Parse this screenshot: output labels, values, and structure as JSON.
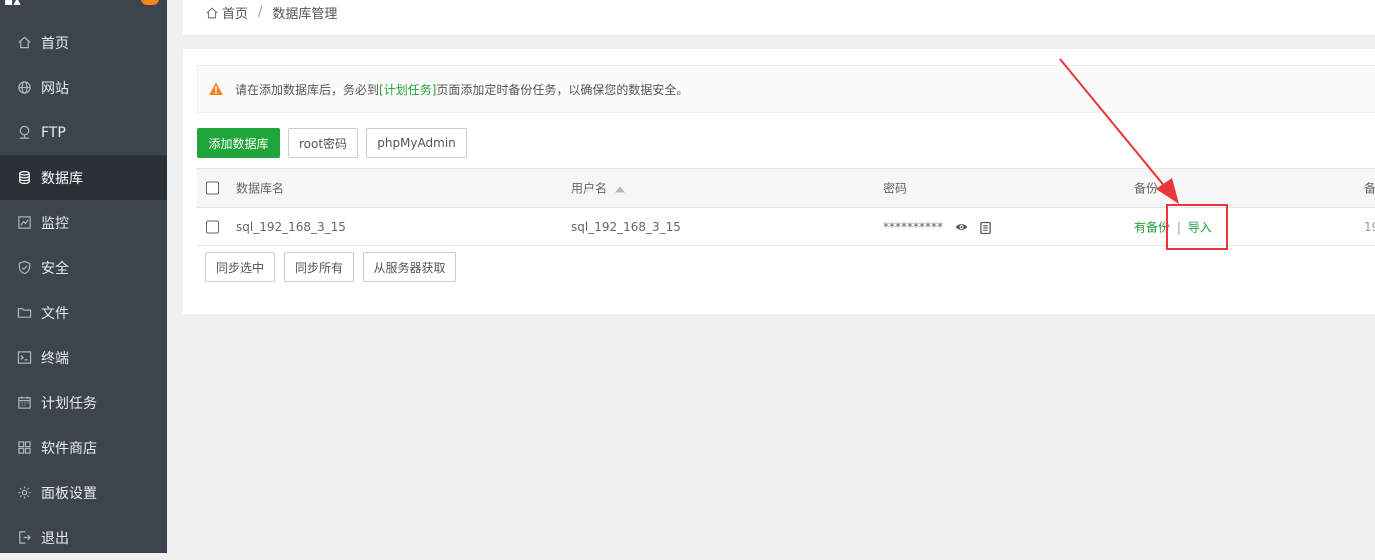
{
  "sidebar": {
    "items": [
      {
        "label": "首页",
        "icon": "home-icon"
      },
      {
        "label": "网站",
        "icon": "globe-icon"
      },
      {
        "label": "FTP",
        "icon": "ftp-icon"
      },
      {
        "label": "数据库",
        "icon": "database-icon",
        "active": true
      },
      {
        "label": "监控",
        "icon": "monitor-icon"
      },
      {
        "label": "安全",
        "icon": "shield-icon"
      },
      {
        "label": "文件",
        "icon": "folder-icon"
      },
      {
        "label": "终端",
        "icon": "terminal-icon"
      },
      {
        "label": "计划任务",
        "icon": "calendar-icon"
      },
      {
        "label": "软件商店",
        "icon": "apps-icon"
      },
      {
        "label": "面板设置",
        "icon": "gear-icon"
      },
      {
        "label": "退出",
        "icon": "logout-icon"
      }
    ]
  },
  "breadcrumb": {
    "home": "首页",
    "separator": "/",
    "current": "数据库管理"
  },
  "alert": {
    "prefix": "请在添加数据库后，务必到",
    "link": "[计划任务]",
    "suffix": "页面添加定时备份任务，以确保您的数据安全。"
  },
  "toolbar": {
    "add_db": "添加数据库",
    "root_password": "root密码",
    "phpmyadmin": "phpMyAdmin"
  },
  "table": {
    "headers": {
      "name": "数据库名",
      "user": "用户名",
      "password": "密码",
      "backup": "备份",
      "remark_partial": "备"
    },
    "rows": [
      {
        "name": "sql_192_168_3_15",
        "user": "sql_192_168_3_15",
        "password": "**********",
        "backup_status": "有备份",
        "backup_sep": "|",
        "import": "导入",
        "remark_partial": "19"
      }
    ]
  },
  "footer_buttons": {
    "sync_selected": "同步选中",
    "sync_all": "同步所有",
    "fetch_from_server": "从服务器获取"
  },
  "colors": {
    "sidebar_bg": "#3c444d",
    "sidebar_active": "#2c3138",
    "primary_green": "#20a53a",
    "annotation_red": "#e8363a",
    "warning_orange": "#f7841f"
  }
}
